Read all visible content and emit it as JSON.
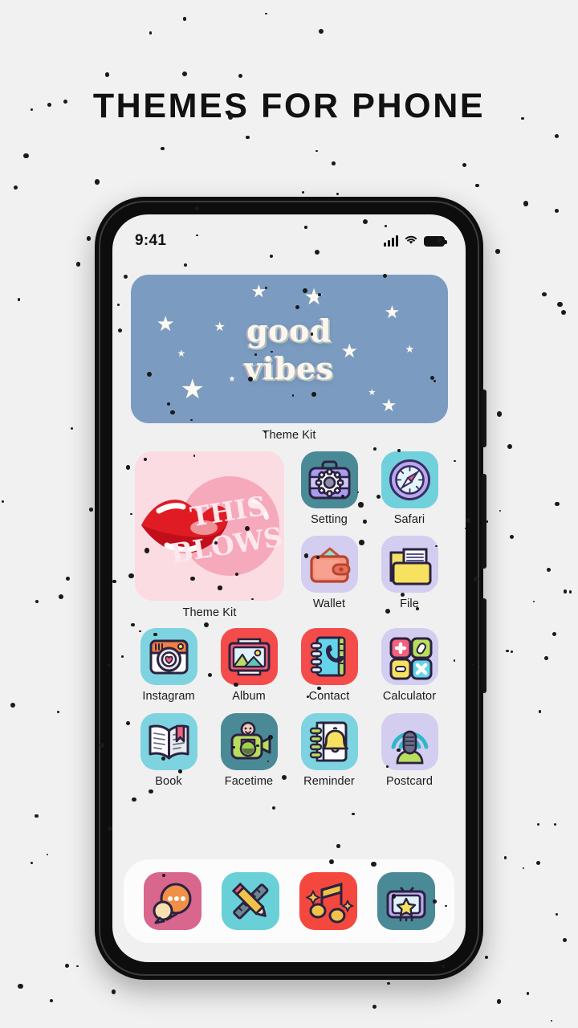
{
  "page": {
    "title": "THEMES FOR PHONE",
    "background_color": "#f1f1f1",
    "accent_dot_color": "#1a1a1a"
  },
  "phone": {
    "bezel_color": "#0d0d0d",
    "screen_background": "#f0f0f0"
  },
  "status_bar": {
    "time": "9:41",
    "signal_icon": "signal-bars-icon",
    "wifi_icon": "wifi-icon",
    "battery_icon": "battery-full-icon"
  },
  "widgets": {
    "large": {
      "label": "Theme Kit",
      "text_line1": "good",
      "text_line2": "vibes",
      "background_color": "#7b9cc0",
      "text_color": "#fbf7ef"
    },
    "medium": {
      "label": "Theme Kit",
      "art_text_line1": "THIS",
      "art_text_line2": "BLOWS",
      "background_color": "#fadce2",
      "lips_color": "#e01b24",
      "bubble_color": "#f6a9bb"
    }
  },
  "apps": {
    "pair_row_1": [
      {
        "label": "Setting",
        "icon": "briefcase-gear-icon",
        "bg": "#4a8a96"
      },
      {
        "label": "Safari",
        "icon": "compass-icon",
        "bg": "#70d0dc"
      }
    ],
    "pair_row_2": [
      {
        "label": "Wallet",
        "icon": "wallet-icon",
        "bg": "#d3cdf0"
      },
      {
        "label": "File",
        "icon": "folder-document-icon",
        "bg": "#d3cdf0"
      }
    ],
    "row_3": [
      {
        "label": "Instagram",
        "icon": "camera-heart-icon",
        "bg": "#7dd4e0"
      },
      {
        "label": "Album",
        "icon": "photo-frame-icon",
        "bg": "#f44b4b"
      },
      {
        "label": "Contact",
        "icon": "phone-book-icon",
        "bg": "#f44b4b"
      },
      {
        "label": "Calculator",
        "icon": "calculator-keys-icon",
        "bg": "#d3cdf0"
      }
    ],
    "row_4": [
      {
        "label": "Book",
        "icon": "open-book-icon",
        "bg": "#7dd4e0"
      },
      {
        "label": "Facetime",
        "icon": "camcorder-icon",
        "bg": "#4a8a96"
      },
      {
        "label": "Reminder",
        "icon": "notebook-bell-icon",
        "bg": "#7dd4e0"
      },
      {
        "label": "Postcard",
        "icon": "podcast-mic-icon",
        "bg": "#d3cdf0"
      }
    ]
  },
  "dock": {
    "background_color": "#fcfcfc",
    "items": [
      {
        "label": "Message",
        "icon": "chat-bubbles-icon",
        "bg": "#d9668c"
      },
      {
        "label": "Notes",
        "icon": "pencil-ruler-icon",
        "bg": "#69d0d8"
      },
      {
        "label": "Music",
        "icon": "music-note-icon",
        "bg": "#f4483f"
      },
      {
        "label": "TV",
        "icon": "tv-star-icon",
        "bg": "#4a8a96"
      }
    ]
  }
}
